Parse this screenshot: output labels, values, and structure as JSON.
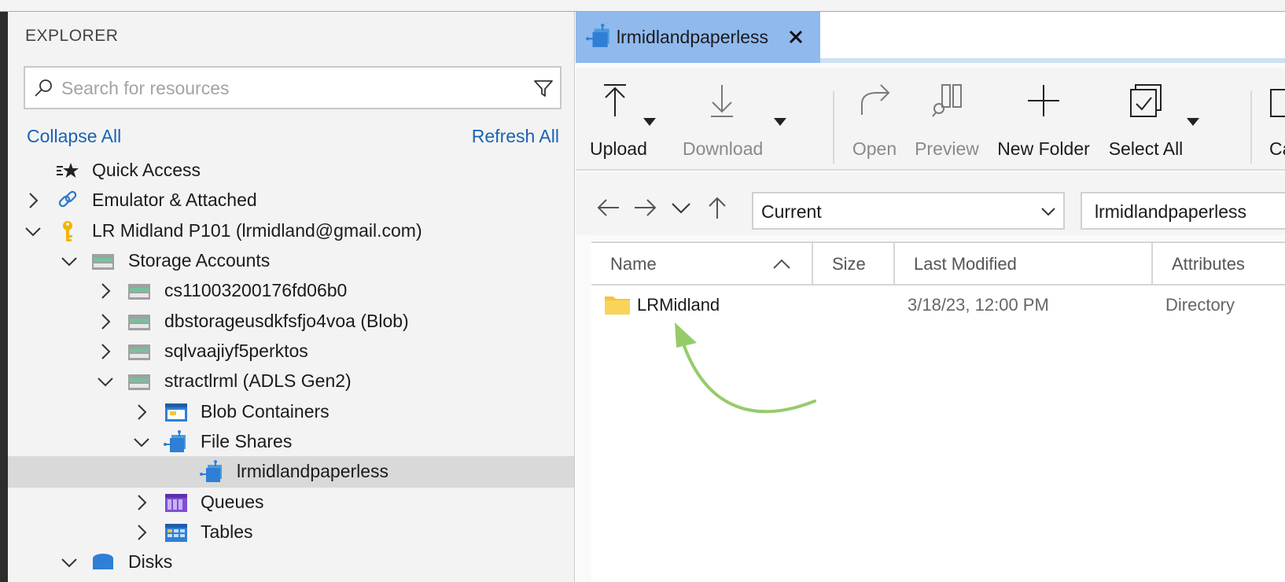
{
  "explorer": {
    "title": "EXPLORER",
    "search": {
      "placeholder": "Search for resources",
      "value": ""
    },
    "collapse_all": "Collapse All",
    "refresh_all": "Refresh All",
    "tree": [
      {
        "label": "Quick Access",
        "icon": "quick-access-icon",
        "expanded": null
      },
      {
        "label": "Emulator & Attached",
        "icon": "link-icon",
        "expanded": false
      },
      {
        "label": "LR Midland P101 (lrmidland@gmail.com)",
        "icon": "key-icon",
        "expanded": true
      },
      {
        "label": "Storage Accounts",
        "icon": "storage-account-icon",
        "expanded": true
      },
      {
        "label": "cs11003200176fd06b0",
        "icon": "storage-account-icon",
        "expanded": false
      },
      {
        "label": "dbstorageusdkfsfjo4voa (Blob)",
        "icon": "storage-account-icon",
        "expanded": false
      },
      {
        "label": "sqlvaajiyf5perktos",
        "icon": "storage-account-icon",
        "expanded": false
      },
      {
        "label": "stractlrml (ADLS Gen2)",
        "icon": "storage-account-icon",
        "expanded": true
      },
      {
        "label": "Blob Containers",
        "icon": "blob-container-icon",
        "expanded": false
      },
      {
        "label": "File Shares",
        "icon": "file-share-icon",
        "expanded": true
      },
      {
        "label": "lrmidlandpaperless",
        "icon": "file-share-icon",
        "expanded": null,
        "selected": true
      },
      {
        "label": "Queues",
        "icon": "queue-icon",
        "expanded": false
      },
      {
        "label": "Tables",
        "icon": "table-icon",
        "expanded": false
      },
      {
        "label": "Disks",
        "icon": "disk-icon",
        "expanded": true
      }
    ]
  },
  "tab": {
    "label": "lrmidlandpaperless",
    "icon": "file-share-icon"
  },
  "toolbar": {
    "upload": "Upload",
    "download": "Download",
    "open": "Open",
    "preview": "Preview",
    "new_folder": "New Folder",
    "select_all": "Select All",
    "cut_partial": "Ca"
  },
  "nav": {
    "view_select": "Current",
    "path": "lrmidlandpaperless"
  },
  "grid": {
    "columns": [
      "Name",
      "Size",
      "Last Modified",
      "Attributes"
    ],
    "sort": {
      "column": "Name",
      "direction": "ascending"
    },
    "rows": [
      {
        "name": "LRMidland",
        "size": "",
        "last_modified": "3/18/23, 12:00 PM",
        "attributes": "Directory"
      }
    ]
  },
  "colors": {
    "tab_active": "#90b9ee",
    "link": "#1a62b3",
    "selection": "#d9d9d9",
    "annotation_arrow": "#96cb6a",
    "folder": "#f5c53f"
  }
}
